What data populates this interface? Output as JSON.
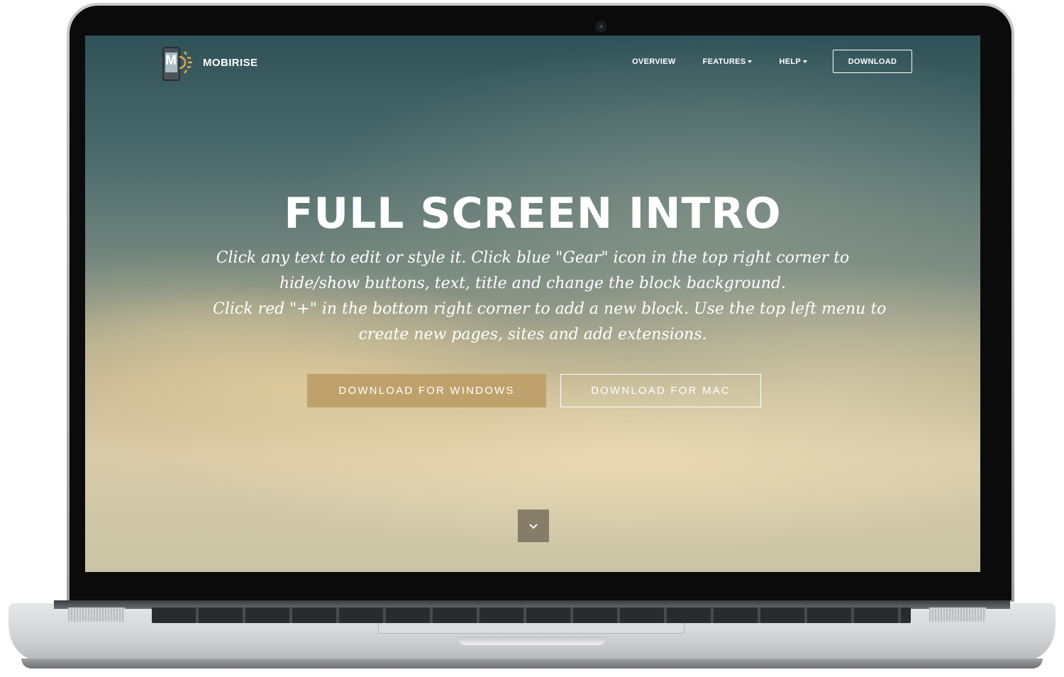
{
  "brand": {
    "name": "MOBIRISE",
    "logo_letter": "M"
  },
  "nav": {
    "items": [
      {
        "label": "OVERVIEW",
        "dropdown": false
      },
      {
        "label": "FEATURES",
        "dropdown": true
      },
      {
        "label": "HELP",
        "dropdown": true
      }
    ],
    "download_label": "DOWNLOAD"
  },
  "hero": {
    "title": "FULL SCREEN INTRO",
    "lines": [
      "Click any text to edit or style it. Click blue \"Gear\" icon in the top right corner to",
      "hide/show buttons, text, title and change the block background.",
      "Click red \"+\" in the bottom right corner to add a new block. Use the top left menu to",
      "create new pages, sites and add extensions."
    ],
    "primary_button": "DOWNLOAD FOR WINDOWS",
    "secondary_button": "DOWNLOAD FOR MAC"
  },
  "colors": {
    "accent": "#bfa16c",
    "sky_top": "#2f5258",
    "sky_bottom": "#d8cbaa"
  },
  "icons": {
    "logo": "mobirise-logo-icon",
    "caret": "caret-down-icon",
    "scroll": "chevron-down-icon"
  }
}
